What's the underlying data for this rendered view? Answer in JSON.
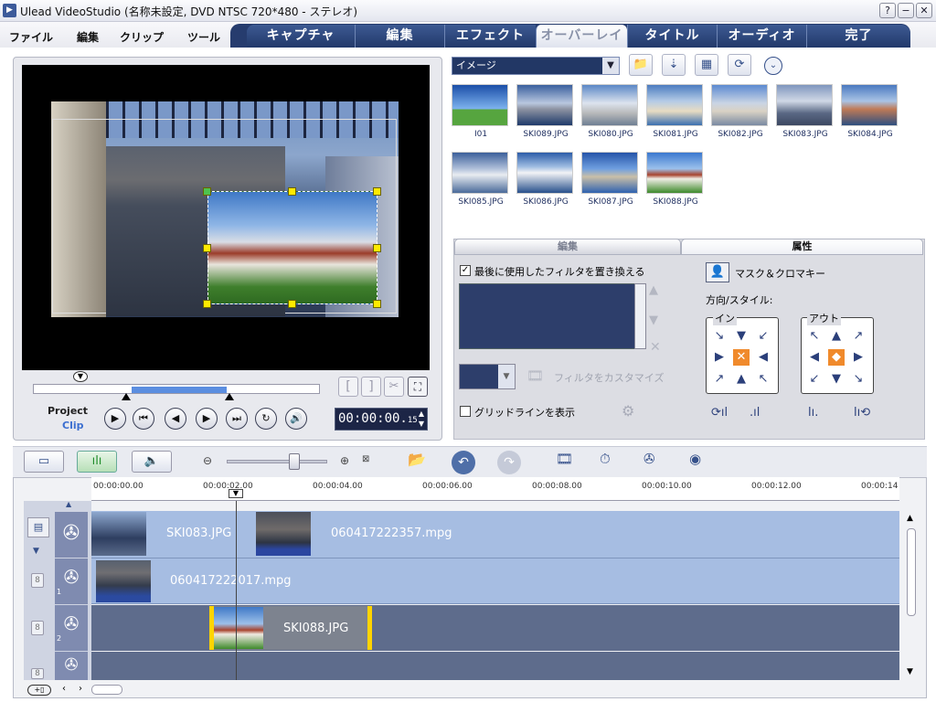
{
  "titlebar": {
    "title": "Ulead VideoStudio (名称未設定, DVD NTSC 720*480 - ステレオ)",
    "help": "?",
    "minimize": "−",
    "close": "✕"
  },
  "menu": [
    "ファイル",
    "編集",
    "クリップ",
    "ツール"
  ],
  "tabs": [
    "キャプチャ",
    "編集",
    "エフェクト",
    "オーバーレイ",
    "タイトル",
    "オーディオ",
    "完了"
  ],
  "active_tab": "オーバーレイ",
  "preview": {
    "project_label": "Project",
    "clip_label": "Clip",
    "timecode": "00:00:00.15",
    "timecode_main": "00:00:00.",
    "timecode_frames": "15",
    "mark_in": "[",
    "mark_out": "]"
  },
  "library": {
    "dropdown_value": "イメージ",
    "items": [
      {
        "name": "I01",
        "color": "#2a5fb0"
      },
      {
        "name": "SKI089.JPG",
        "color": "#5a78a8"
      },
      {
        "name": "SKI080.JPG",
        "color": "#8aa6cf"
      },
      {
        "name": "SKI081.JPG",
        "color": "#9fb9d8"
      },
      {
        "name": "SKI082.JPG",
        "color": "#a7bfdc"
      },
      {
        "name": "SKI083.JPG",
        "color": "#6e7ea0"
      },
      {
        "name": "SKI084.JPG",
        "color": "#6f8fba"
      },
      {
        "name": "SKI085.JPG",
        "color": "#4b6c9c"
      },
      {
        "name": "SKI086.JPG",
        "color": "#3d6aa8"
      },
      {
        "name": "SKI087.JPG",
        "color": "#4b7fc4"
      },
      {
        "name": "SKI088.JPG",
        "color": "#5b8fd0"
      }
    ]
  },
  "attributes": {
    "tab_edit": "編集",
    "tab_attr": "属性",
    "replace_filter_label": "最後に使用したフィルタを置き換える",
    "customize_filter_label": "フィルタをカスタマイズ",
    "grid_label": "グリッドラインを表示",
    "mask_label": "マスク＆クロマキー",
    "direction_label": "方向/スタイル:",
    "in_label": "イン",
    "out_label": "アウト"
  },
  "timeline": {
    "ruler": [
      "00:00:00.00",
      "00:00:02.00",
      "00:00:04.00",
      "00:00:06.00",
      "00:00:08.00",
      "00:00:10.00",
      "00:00:12.00",
      "00:00:14"
    ],
    "clips": {
      "video1": "SKI083.JPG",
      "video2": "060417222357.mpg",
      "overlay1": "060417222017.mpg",
      "overlay2": "SKI088.JPG"
    },
    "track_numbers": [
      "1",
      "2"
    ]
  }
}
